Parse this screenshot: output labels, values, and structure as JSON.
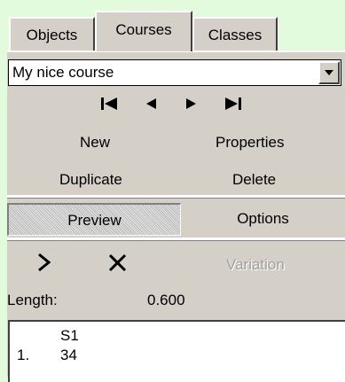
{
  "tabs": [
    {
      "label": "Objects",
      "active": false
    },
    {
      "label": "Courses",
      "active": true
    },
    {
      "label": "Classes",
      "active": false
    }
  ],
  "course_select": {
    "value": "My nice course"
  },
  "nav_icons": [
    "first-icon",
    "previous-icon",
    "next-icon",
    "last-icon"
  ],
  "actions": {
    "new_label": "New",
    "properties_label": "Properties",
    "duplicate_label": "Duplicate",
    "delete_label": "Delete"
  },
  "mode": {
    "preview_label": "Preview",
    "options_label": "Options",
    "selected": "Preview"
  },
  "tools": {
    "next_icon": "chevron-right-icon",
    "delete_icon": "x-icon",
    "variation_label": "Variation",
    "variation_enabled": false
  },
  "length": {
    "label": "Length:",
    "value": "0.600"
  },
  "control_list": {
    "header": "S1",
    "rows": [
      {
        "index": "1.",
        "value": "34"
      }
    ]
  },
  "colors": {
    "background": "#e2fbdc",
    "panel": "#d4d0c8",
    "disabled": "#a0a0a0"
  }
}
